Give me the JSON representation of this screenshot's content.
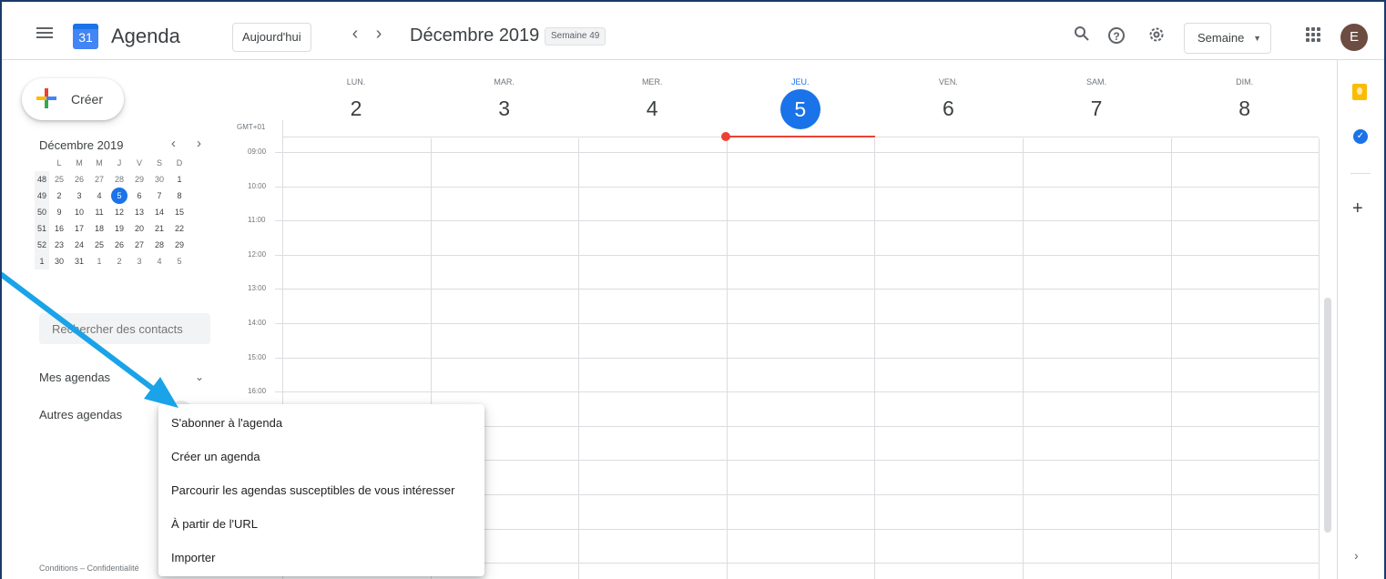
{
  "header": {
    "app_title": "Agenda",
    "logo_day": "31",
    "today_button": "Aujourd'hui",
    "prev_icon": "‹",
    "next_icon": "›",
    "month": "Décembre 2019",
    "week_badge": "Semaine 49",
    "view_selector": "Semaine",
    "avatar_letter": "E"
  },
  "sidebar": {
    "create_label": "Créer",
    "mini_calendar": {
      "title": "Décembre 2019",
      "weekday_headers": [
        "L",
        "M",
        "M",
        "J",
        "V",
        "S",
        "D"
      ],
      "weeks": [
        {
          "week": "48",
          "days": [
            "25",
            "26",
            "27",
            "28",
            "29",
            "30",
            "1"
          ]
        },
        {
          "week": "49",
          "days": [
            "2",
            "3",
            "4",
            "5",
            "6",
            "7",
            "8"
          ]
        },
        {
          "week": "50",
          "days": [
            "9",
            "10",
            "11",
            "12",
            "13",
            "14",
            "15"
          ]
        },
        {
          "week": "51",
          "days": [
            "16",
            "17",
            "18",
            "19",
            "20",
            "21",
            "22"
          ]
        },
        {
          "week": "52",
          "days": [
            "23",
            "24",
            "25",
            "26",
            "27",
            "28",
            "29"
          ]
        },
        {
          "week": "1",
          "days": [
            "30",
            "31",
            "1",
            "2",
            "3",
            "4",
            "5"
          ]
        }
      ],
      "selected_day": "5"
    },
    "search_placeholder": "Rechercher des contacts",
    "my_calendars": "Mes agendas",
    "other_calendars": "Autres agendas",
    "footer": "Conditions – Confidentialité"
  },
  "week_view": {
    "timezone": "GMT+01",
    "days": [
      {
        "name": "LUN.",
        "date": "2"
      },
      {
        "name": "MAR.",
        "date": "3"
      },
      {
        "name": "MER.",
        "date": "4"
      },
      {
        "name": "JEU.",
        "date": "5"
      },
      {
        "name": "VEN.",
        "date": "6"
      },
      {
        "name": "SAM.",
        "date": "7"
      },
      {
        "name": "DIM.",
        "date": "8"
      }
    ],
    "hours": [
      "09:00",
      "10:00",
      "11:00",
      "12:00",
      "13:00",
      "14:00",
      "15:00",
      "16:00"
    ]
  },
  "context_menu": {
    "items": [
      "S'abonner à l'agenda",
      "Créer un agenda",
      "Parcourir les agendas susceptibles de vous intéresser",
      "À partir de l'URL",
      "Importer"
    ]
  },
  "colors": {
    "accent": "#1a73e8",
    "now_indicator": "#ea4335",
    "annotation_arrow": "#1aa3e8"
  }
}
